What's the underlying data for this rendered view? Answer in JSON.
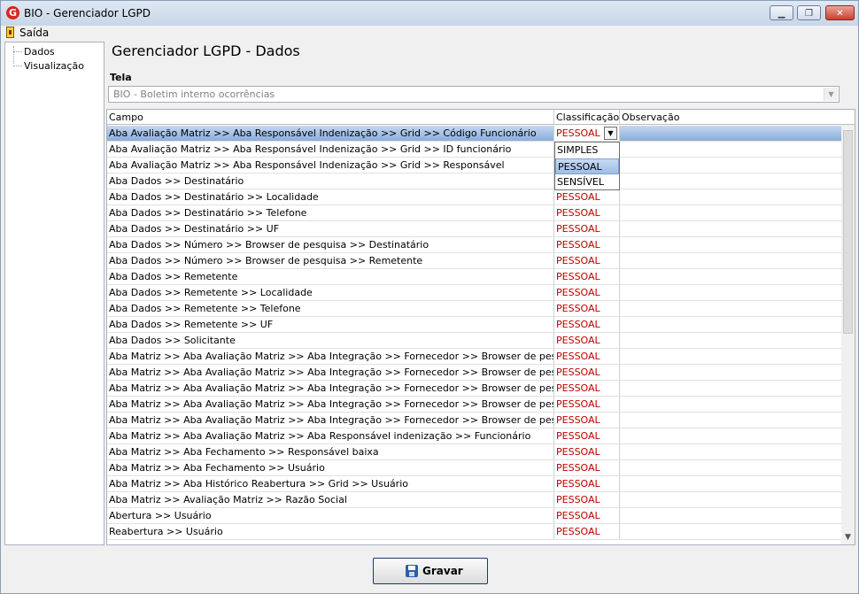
{
  "window": {
    "title": "BIO - Gerenciador LGPD",
    "minimize": "▁",
    "maximize": "❐",
    "close": "✕"
  },
  "menu": {
    "exit_label": "Saída"
  },
  "tree": {
    "items": [
      "Dados",
      "Visualização"
    ]
  },
  "main": {
    "title": "Gerenciador LGPD - Dados",
    "tela_label": "Tela",
    "tela_value": "BIO - Boletim interno ocorrências"
  },
  "grid": {
    "columns": [
      "Campo",
      "Classificação",
      "Observação"
    ],
    "rows": [
      {
        "campo": "Aba Avaliação Matriz >> Aba Responsável Indenização >> Grid >> Código Funcionário",
        "classificacao": "PESSOAL",
        "observacao": ""
      },
      {
        "campo": "Aba Avaliação Matriz >> Aba Responsável Indenização >> Grid >> ID funcionário",
        "classificacao": "",
        "observacao": ""
      },
      {
        "campo": "Aba Avaliação Matriz >> Aba Responsável Indenização >> Grid >> Responsável",
        "classificacao": "",
        "observacao": ""
      },
      {
        "campo": "Aba Dados >> Destinatário",
        "classificacao": "",
        "observacao": ""
      },
      {
        "campo": "Aba Dados >> Destinatário >> Localidade",
        "classificacao": "PESSOAL",
        "observacao": ""
      },
      {
        "campo": "Aba Dados >> Destinatário >> Telefone",
        "classificacao": "PESSOAL",
        "observacao": ""
      },
      {
        "campo": "Aba Dados >> Destinatário >> UF",
        "classificacao": "PESSOAL",
        "observacao": ""
      },
      {
        "campo": "Aba Dados >> Número >> Browser de pesquisa >> Destinatário",
        "classificacao": "PESSOAL",
        "observacao": ""
      },
      {
        "campo": "Aba Dados >> Número >> Browser de pesquisa >> Remetente",
        "classificacao": "PESSOAL",
        "observacao": ""
      },
      {
        "campo": "Aba Dados >> Remetente",
        "classificacao": "PESSOAL",
        "observacao": ""
      },
      {
        "campo": "Aba Dados >> Remetente >> Localidade",
        "classificacao": "PESSOAL",
        "observacao": ""
      },
      {
        "campo": "Aba Dados >> Remetente >> Telefone",
        "classificacao": "PESSOAL",
        "observacao": ""
      },
      {
        "campo": "Aba Dados >> Remetente >> UF",
        "classificacao": "PESSOAL",
        "observacao": ""
      },
      {
        "campo": "Aba Dados >> Solicitante",
        "classificacao": "PESSOAL",
        "observacao": ""
      },
      {
        "campo": "Aba Matriz >> Aba Avaliação Matriz >> Aba Integração >> Fornecedor >> Browser de pesquisa >> Inscri...",
        "classificacao": "PESSOAL",
        "observacao": ""
      },
      {
        "campo": "Aba Matriz >> Aba Avaliação Matriz >> Aba Integração >> Fornecedor >> Browser de pesquisa >> Interno",
        "classificacao": "PESSOAL",
        "observacao": ""
      },
      {
        "campo": "Aba Matriz >> Aba Avaliação Matriz >> Aba Integração >> Fornecedor >> Browser de pesquisa >> Nome",
        "classificacao": "PESSOAL",
        "observacao": ""
      },
      {
        "campo": "Aba Matriz >> Aba Avaliação Matriz >> Aba Integração >> Fornecedor >> Browser de pesquisa >> Núm...",
        "classificacao": "PESSOAL",
        "observacao": ""
      },
      {
        "campo": "Aba Matriz >> Aba Avaliação Matriz >> Aba Integração >> Fornecedor >> Browser de pesquisa >> Razã...",
        "classificacao": "PESSOAL",
        "observacao": ""
      },
      {
        "campo": "Aba Matriz >> Aba Avaliação Matriz >> Aba Responsável indenização >> Funcionário",
        "classificacao": "PESSOAL",
        "observacao": ""
      },
      {
        "campo": "Aba Matriz >> Aba Fechamento >> Responsável baixa",
        "classificacao": "PESSOAL",
        "observacao": ""
      },
      {
        "campo": "Aba Matriz >> Aba Fechamento >> Usuário",
        "classificacao": "PESSOAL",
        "observacao": ""
      },
      {
        "campo": "Aba Matriz >> Aba Histórico Reabertura >> Grid >> Usuário",
        "classificacao": "PESSOAL",
        "observacao": ""
      },
      {
        "campo": "Aba Matriz >> Avaliação Matriz >> Razão Social",
        "classificacao": "PESSOAL",
        "observacao": ""
      },
      {
        "campo": "Abertura >> Usuário",
        "classificacao": "PESSOAL",
        "observacao": ""
      },
      {
        "campo": "Reabertura >> Usuário",
        "classificacao": "PESSOAL",
        "observacao": ""
      }
    ],
    "dropdown_options": [
      "SIMPLES",
      "PESSOAL",
      "SENSÍVEL"
    ],
    "dropdown_highlighted": "PESSOAL"
  },
  "footer": {
    "save_label": "Gravar"
  },
  "colors": {
    "classification_text": "#c00000",
    "selected_row": "#8aaedb"
  }
}
